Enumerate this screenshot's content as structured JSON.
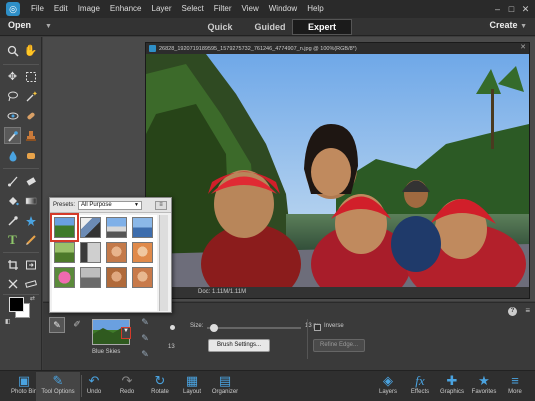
{
  "menubar": {
    "items": [
      "File",
      "Edit",
      "Image",
      "Enhance",
      "Layer",
      "Select",
      "Filter",
      "View",
      "Window",
      "Help"
    ],
    "window_controls": [
      "–",
      "□",
      "✕"
    ]
  },
  "modebar": {
    "open_label": "Open",
    "open_arrow": "▼",
    "tabs": [
      "Quick",
      "Guided",
      "Expert"
    ],
    "active_tab": "Expert",
    "create_label": "Create",
    "create_arrow": "▼"
  },
  "document": {
    "title": "26828_1920719189595_1579275732_761246_4774907_n.jpg @ 100%(RGB/8*)",
    "close": "✕",
    "status": "Doc: 1.11M/1.11M"
  },
  "presets": {
    "label": "Presets:",
    "selected": "All Purpose",
    "menu_glyph": "≡"
  },
  "tool_options": {
    "thumb_label": "Blue Skies",
    "size_label": "Size:",
    "size_value": "13 px",
    "size_number": "13",
    "brush_settings": "Brush Settings...",
    "inverse_label": "Inverse",
    "refine_edge": "Refine Edge...",
    "help": "?",
    "menu": "≡"
  },
  "taskbar": {
    "items": [
      {
        "label": "Photo Bin",
        "icon": "photo-bin-icon"
      },
      {
        "label": "Tool Options",
        "icon": "tool-options-icon"
      },
      {
        "label": "Undo",
        "icon": "undo-icon"
      },
      {
        "label": "Redo",
        "icon": "redo-icon"
      },
      {
        "label": "Rotate",
        "icon": "rotate-icon"
      },
      {
        "label": "Layout",
        "icon": "layout-icon"
      },
      {
        "label": "Organizer",
        "icon": "organizer-icon"
      },
      {
        "label": "Layers",
        "icon": "layers-icon"
      },
      {
        "label": "Effects",
        "icon": "effects-icon"
      },
      {
        "label": "Graphics",
        "icon": "graphics-icon"
      },
      {
        "label": "Favorites",
        "icon": "favorites-icon"
      },
      {
        "label": "More",
        "icon": "more-icon"
      }
    ]
  },
  "colors": {
    "accent": "#2e8fc7",
    "highlight": "#d43a2a"
  }
}
